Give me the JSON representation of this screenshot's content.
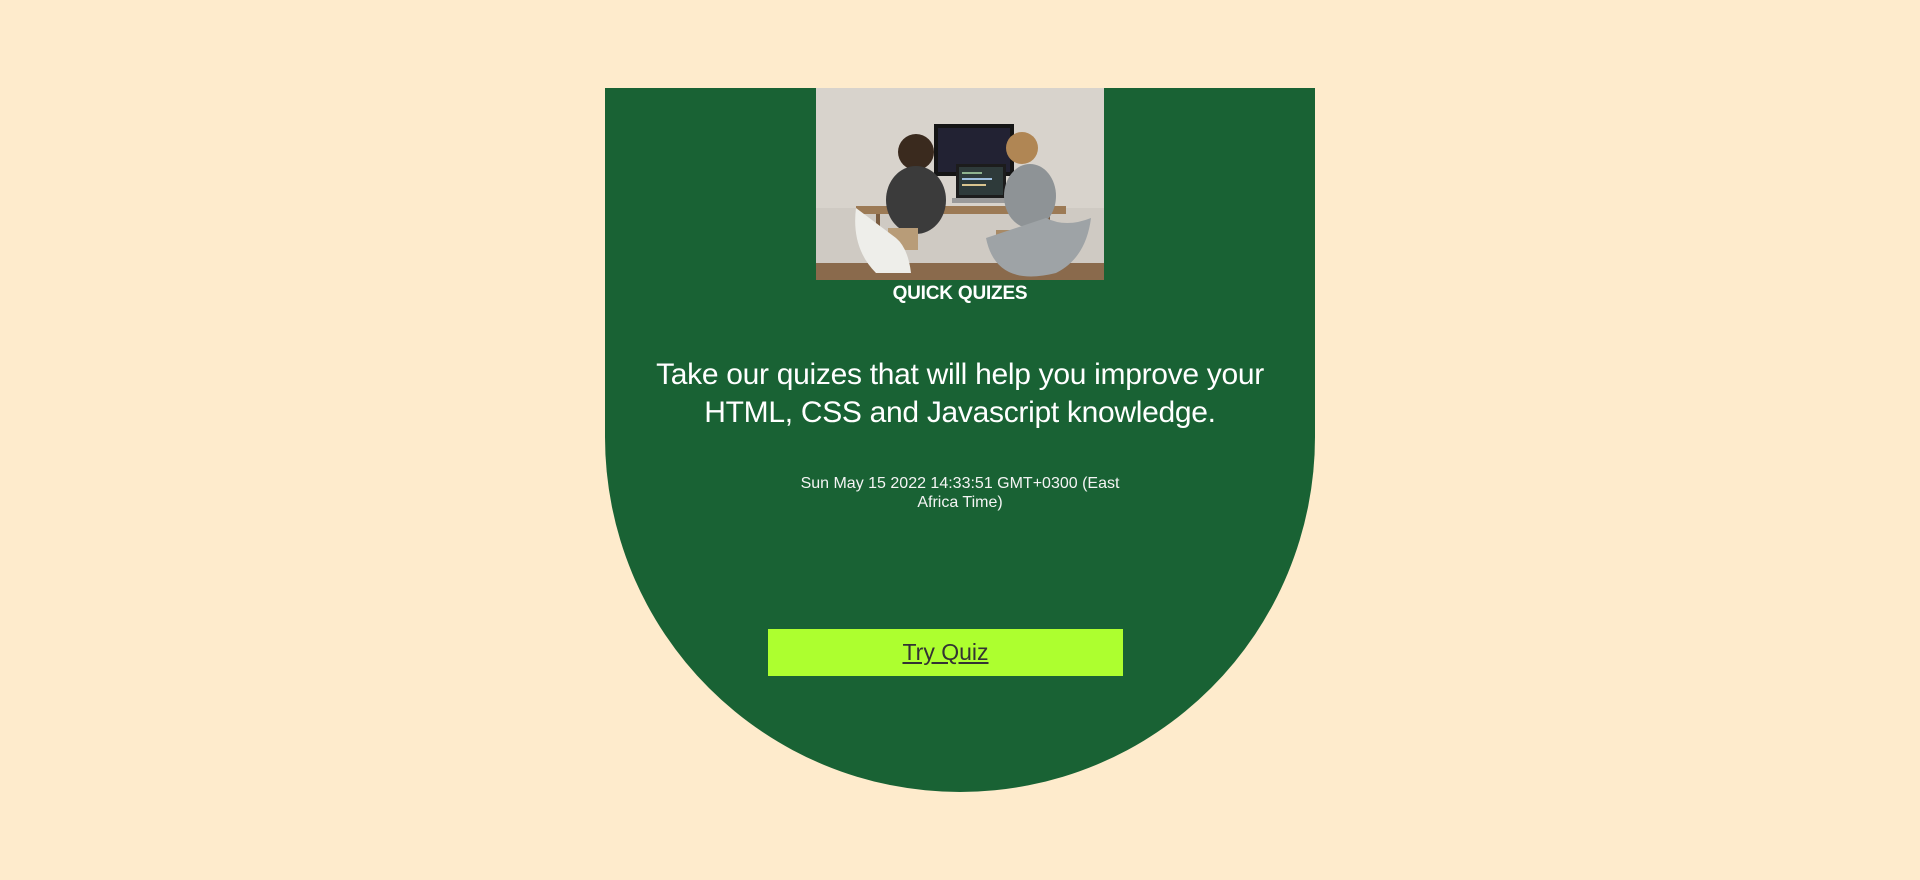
{
  "card": {
    "title": "QUICK QUIZES",
    "description": "Take our quizes that will help you improve your HTML, CSS and Javascript knowledge.",
    "datetime": "Sun May 15 2022 14:33:51 GMT+0300 (East Africa Time)",
    "button_label": "Try Quiz"
  },
  "colors": {
    "page_background": "#feebcc",
    "card_background": "#196234",
    "button_background": "#adff2f",
    "button_text": "#333333"
  }
}
